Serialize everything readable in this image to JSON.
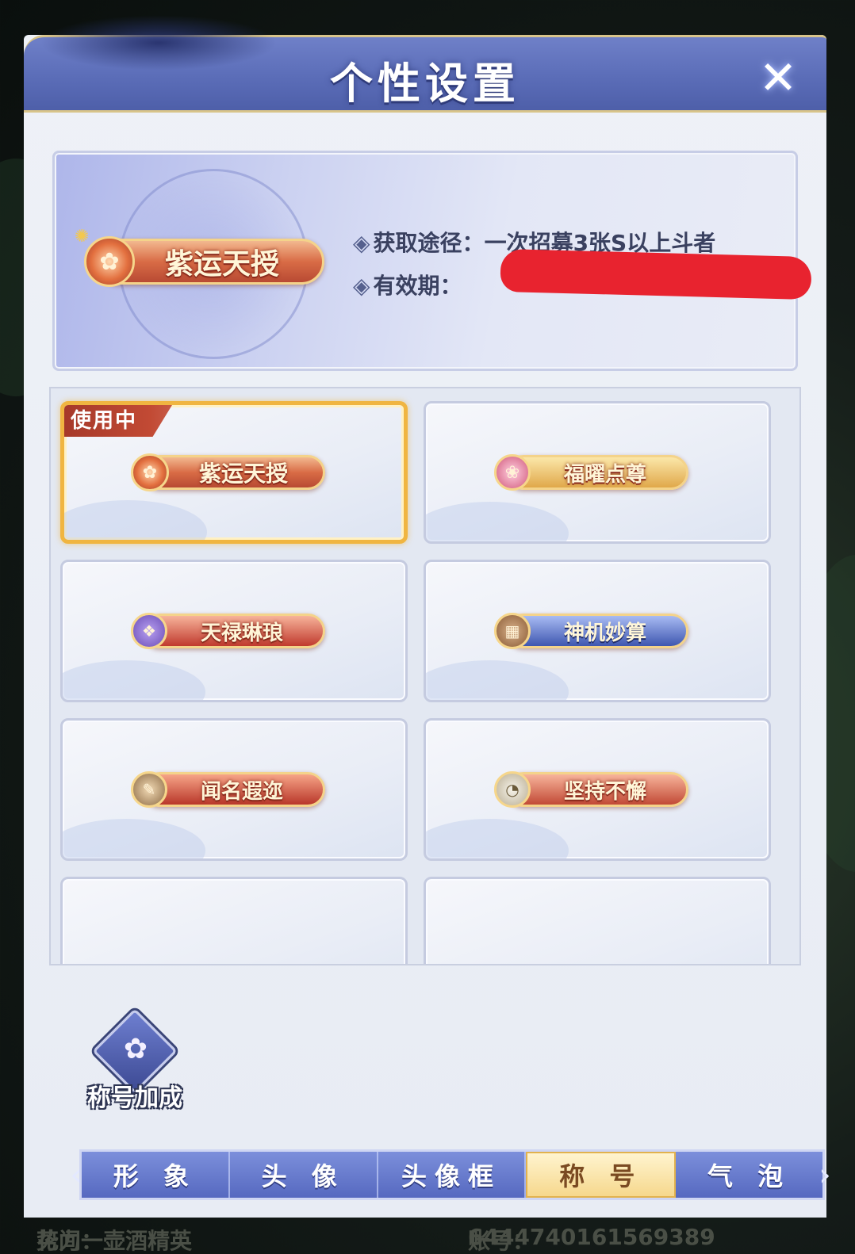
{
  "header": {
    "title": "个性设置"
  },
  "preview": {
    "title_name": "紫运天授",
    "source_label": "获取途径：",
    "source_value": "一次招募3张S以上斗者",
    "validity_label": "有效期："
  },
  "titles": [
    {
      "name": "紫运天授",
      "in_use": true,
      "colors": [
        "#f2b88f",
        "#b84a33"
      ]
    },
    {
      "name": "福曜点尊",
      "in_use": false,
      "colors": [
        "#f7dc8f",
        "#d39a3a"
      ]
    },
    {
      "name": "天禄琳琅",
      "in_use": false,
      "colors": [
        "#f39a7a",
        "#c03a2e"
      ]
    },
    {
      "name": "神机妙算",
      "in_use": false,
      "colors": [
        "#7f9be6",
        "#3f57b0"
      ]
    },
    {
      "name": "闻名遐迩",
      "in_use": false,
      "colors": [
        "#f18a6c",
        "#b9372a"
      ]
    },
    {
      "name": "坚持不懈",
      "in_use": false,
      "colors": [
        "#f3a384",
        "#c24a36"
      ]
    }
  ],
  "in_use_label": "使用中",
  "bonus": {
    "label": "称号加成"
  },
  "tabs": [
    {
      "label": "形 象",
      "selected": false
    },
    {
      "label": "头 像",
      "selected": false
    },
    {
      "label": "头像框",
      "selected": false
    },
    {
      "label": "称 号",
      "selected": true
    },
    {
      "label": "气 泡",
      "selected": false
    }
  ],
  "footer": {
    "faction_label": "势力：",
    "faction_value": "花间一壶酒精英",
    "account_label": "账号：",
    "account_value": "644474016156938​9"
  },
  "colors": {
    "accent": "#5b6db8",
    "selected_tab": "#f6d88d",
    "active_border": "#f0b541"
  }
}
